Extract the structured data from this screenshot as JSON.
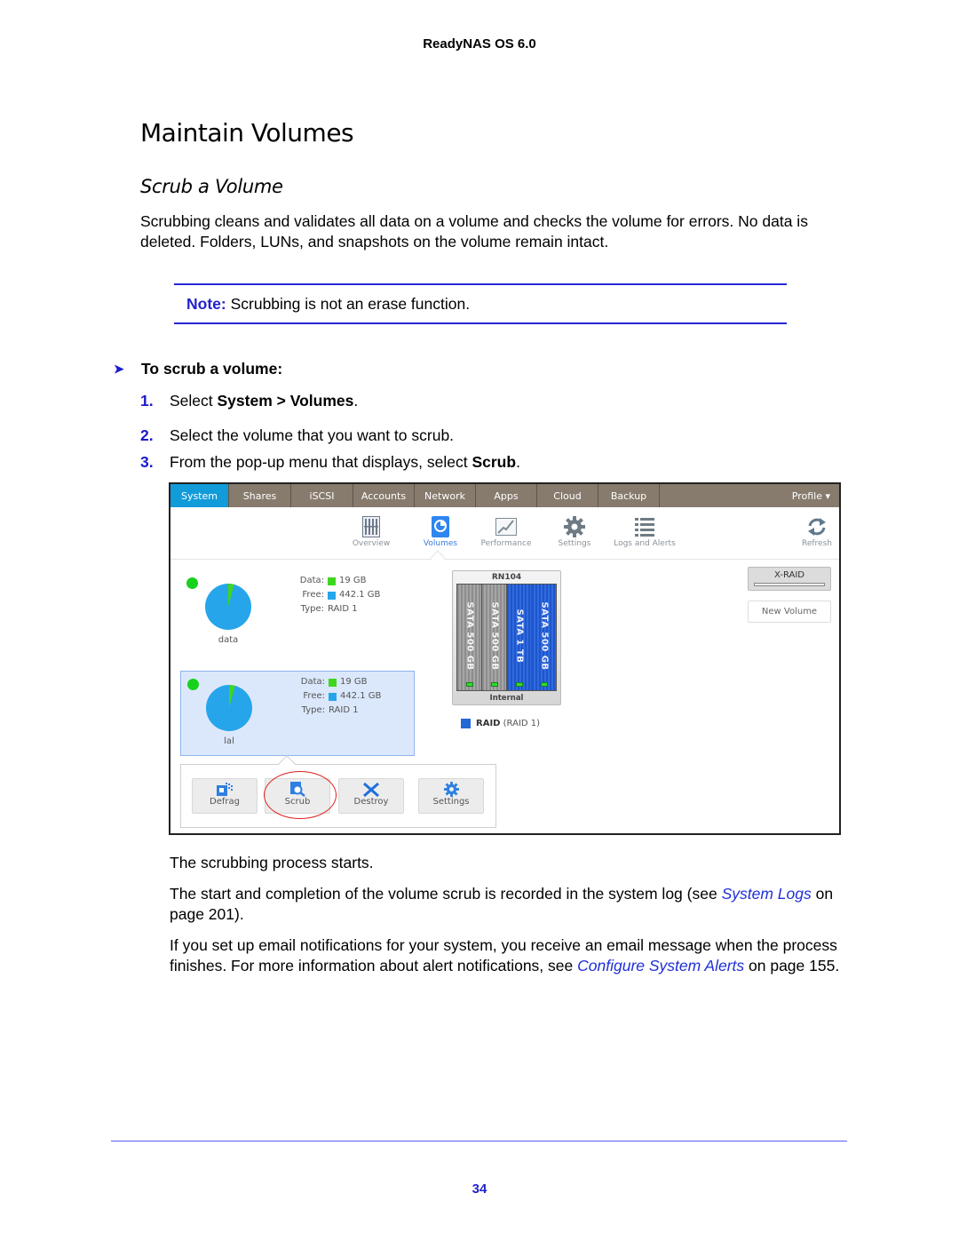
{
  "running_header": "ReadyNAS OS 6.0",
  "section_title": "Maintain Volumes",
  "subsection_title": "Scrub a Volume",
  "intro": "Scrubbing cleans and validates all data on a volume and checks the volume for errors. No data is deleted. Folders, LUNs, and snapshots on the volume remain intact.",
  "note": {
    "label": "Note:",
    "text": "Scrubbing is not an erase function."
  },
  "procedure": {
    "title": "To scrub a volume:",
    "steps": [
      {
        "num": "1.",
        "pre": "Select ",
        "bold1": "System",
        "mid": " > ",
        "bold2": "Volumes",
        "post": "."
      },
      {
        "num": "2.",
        "text": "Select the volume that you want to scrub."
      },
      {
        "num": "3.",
        "pre": "From the pop-up menu that displays, select ",
        "bold": "Scrub",
        "post": "."
      }
    ]
  },
  "ui": {
    "tabs": [
      {
        "label": "System",
        "active": true
      },
      {
        "label": "Shares"
      },
      {
        "label": "iSCSI"
      },
      {
        "label": "Accounts"
      },
      {
        "label": "Network"
      },
      {
        "label": "Apps"
      },
      {
        "label": "Cloud"
      },
      {
        "label": "Backup"
      }
    ],
    "profile": "Profile ▾",
    "subnav": [
      {
        "label": "Overview",
        "icon": "overview-icon"
      },
      {
        "label": "Volumes",
        "icon": "volumes-icon",
        "active": true
      },
      {
        "label": "Performance",
        "icon": "performance-icon"
      },
      {
        "label": "Settings",
        "icon": "gear-icon"
      },
      {
        "label": "Logs and Alerts",
        "icon": "list-icon"
      }
    ],
    "refresh": "Refresh",
    "volumes": [
      {
        "name": "data",
        "data_label": "Data:",
        "data_value": "19 GB",
        "free_label": "Free:",
        "free_value": "442.1 GB",
        "type_label": "Type:",
        "type_value": "RAID 1",
        "used_fraction": 0.041,
        "status_color": "#17d11c"
      },
      {
        "name": "lal",
        "data_label": "Data:",
        "data_value": "19 GB",
        "free_label": "Free:",
        "free_value": "442.1 GB",
        "type_label": "Type:",
        "type_value": "RAID 1",
        "used_fraction": 0.041,
        "status_color": "#17d11c",
        "selected": true
      }
    ],
    "colors": {
      "data": "#3fd61f",
      "free": "#26a5ea",
      "raid": "#2467d6",
      "active_tab": "#129bd9",
      "nav_bg": "#877b6e"
    },
    "chassis": {
      "model": "RN104",
      "location": "Internal",
      "bays": [
        {
          "label": "SATA 500 GB",
          "color": "gray"
        },
        {
          "label": "SATA 500 GB",
          "color": "gray"
        },
        {
          "label": "SATA 1 TB",
          "color": "blue"
        },
        {
          "label": "SATA 500 GB",
          "color": "blue"
        }
      ]
    },
    "raid_legend": {
      "name": "RAID",
      "level": "(RAID 1)"
    },
    "xraid": "X-RAID",
    "new_volume": "New Volume",
    "popup_buttons": [
      {
        "label": "Defrag",
        "icon": "defrag-icon"
      },
      {
        "label": "Scrub",
        "icon": "scrub-icon",
        "highlighted": true
      },
      {
        "label": "Destroy",
        "icon": "destroy-icon"
      },
      {
        "label": "Settings",
        "icon": "gear-icon"
      }
    ]
  },
  "after": {
    "p1": "The scrubbing process starts.",
    "p2_pre": "The start and completion of the volume scrub is recorded in the system log (see ",
    "p2_link": "System Logs",
    "p2_post": " on page 201).",
    "p3_pre": "If you set up email notifications for your system, you receive an email message when the process finishes. For more information about alert notifications, see ",
    "p3_link": "Configure System Alerts",
    "p3_post": " on page 155."
  },
  "page_number": "34"
}
